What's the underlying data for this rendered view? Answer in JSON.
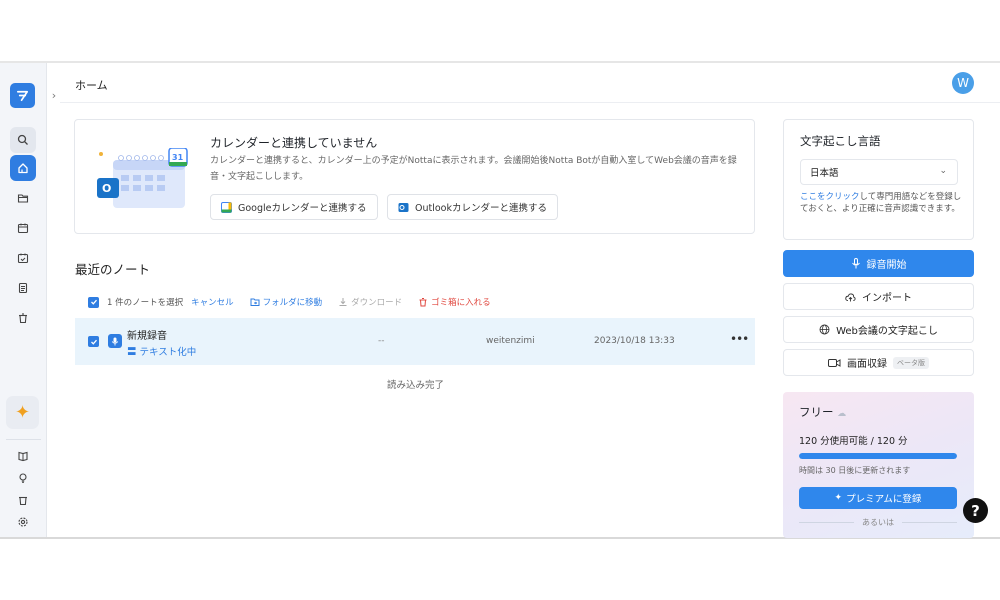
{
  "header": {
    "breadcrumb": "ホーム",
    "avatar_initial": "W"
  },
  "calendar_card": {
    "title": "カレンダーと連携していません",
    "description": "カレンダーと連携すると、カレンダー上の予定がNottaに表示されます。会議開始後Notta Botが自動入室してWeb会議の音声を録音・文字起こしします。",
    "google_button": "Googleカレンダーと連携する",
    "outlook_button": "Outlookカレンダーと連携する",
    "illustration_day": "31"
  },
  "recent": {
    "title": "最近のノート",
    "toolbar": {
      "selected_count": "1 件のノートを選択",
      "cancel": "キャンセル",
      "move_to_folder": "フォルダに移動",
      "download": "ダウンロード",
      "trash": "ゴミ箱に入れる"
    },
    "notes": [
      {
        "title": "新規録音",
        "status": "テキスト化中",
        "duration": "--",
        "owner": "weitenzimi",
        "date": "2023/10/18 13:33"
      }
    ],
    "loaded_text": "読み込み完了"
  },
  "transcription_language": {
    "title": "文字起こし言語",
    "selected": "日本語",
    "note_link": "ここをクリック",
    "note_text": "して専門用語などを登録しておくと、より正確に音声認識できます。"
  },
  "actions": {
    "record": "録音開始",
    "import": "インポート",
    "web_meeting": "Web会議の文字起こし",
    "screen_record": "画面収録",
    "beta_badge": "ベータ版"
  },
  "plan": {
    "name": "フリー",
    "usage": "120 分使用可能 / 120 分",
    "usage_fraction": 1.0,
    "renew_text": "時間は 30 日後に更新されます",
    "upgrade_button": "プレミアムに登録",
    "or_text": "あるいは"
  },
  "colors": {
    "accent": "#2f7de1",
    "primary_button": "#2f87ec",
    "danger": "#e0463d"
  }
}
